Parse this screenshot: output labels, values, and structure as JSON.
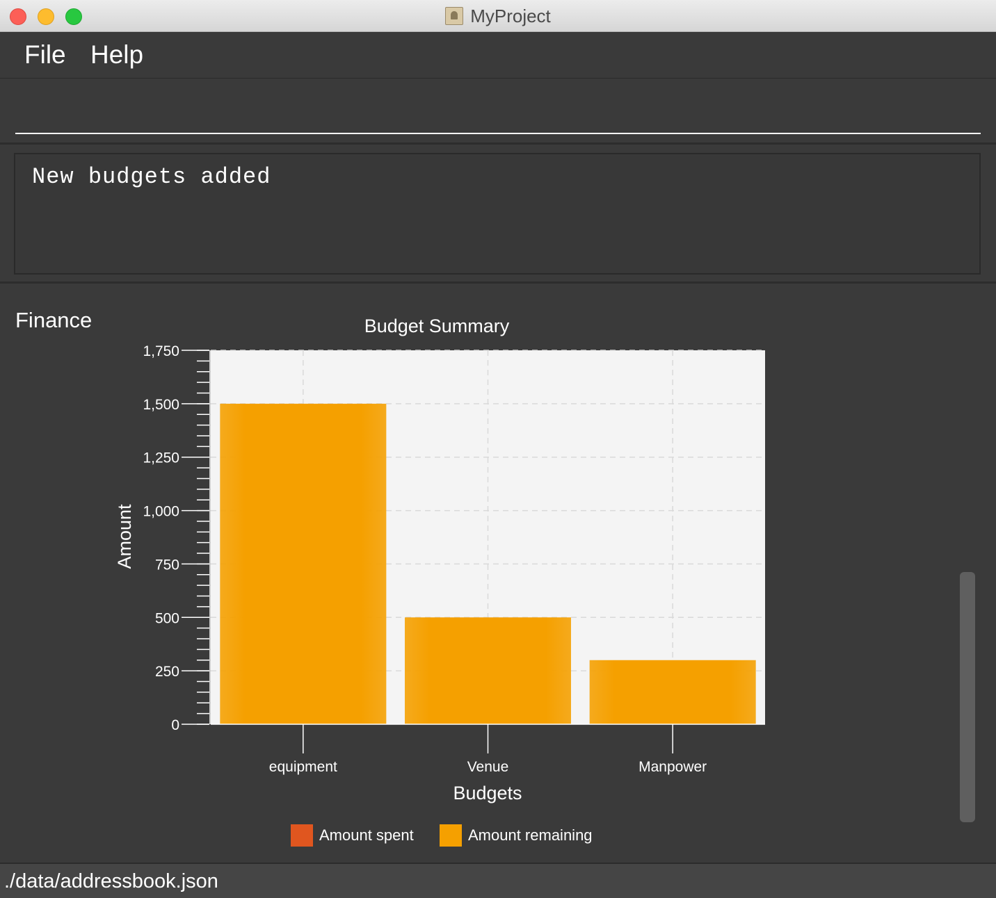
{
  "window": {
    "title": "MyProject"
  },
  "menu": {
    "file_label": "File",
    "help_label": "Help"
  },
  "command": {
    "value": "",
    "placeholder": ""
  },
  "result": {
    "text": "New budgets added"
  },
  "finance": {
    "panel_label": "Finance"
  },
  "status": {
    "path": "./data/addressbook.json"
  },
  "chart_data": {
    "type": "bar",
    "title": "Budget Summary",
    "xlabel": "Budgets",
    "ylabel": "Amount",
    "ylim": [
      0,
      1750
    ],
    "yticks": [
      0,
      250,
      500,
      750,
      1000,
      1250,
      1500,
      1750
    ],
    "ytick_labels": [
      "0",
      "250",
      "500",
      "750",
      "1,000",
      "1,250",
      "1,500",
      "1,750"
    ],
    "categories": [
      "equipment",
      "Venue",
      "Manpower"
    ],
    "series": [
      {
        "name": "Amount spent",
        "color": "#e0561f",
        "values": [
          0,
          0,
          0
        ]
      },
      {
        "name": "Amount remaining",
        "color": "#f5a000",
        "values": [
          1500,
          500,
          300
        ]
      }
    ],
    "grid": true,
    "legend_position": "bottom"
  }
}
